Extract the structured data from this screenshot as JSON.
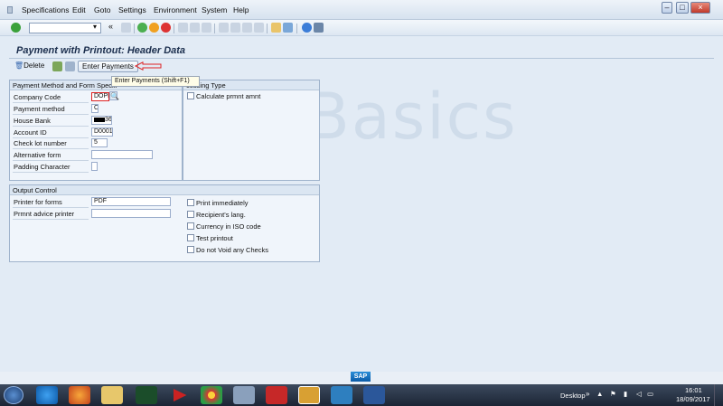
{
  "menu": [
    "Specifications",
    "Edit",
    "Goto",
    "Settings",
    "Environment",
    "System",
    "Help"
  ],
  "title": "Payment with Printout: Header Data",
  "app_toolbar": {
    "delete_label": "Delete",
    "enter_payments_label": "Enter Payments",
    "tooltip": "Enter Payments    (Shift+F1)"
  },
  "payment_group": {
    "title": "Payment Method and Form Specifi",
    "fields": [
      {
        "label": "Company Code",
        "value": "DOPD"
      },
      {
        "label": "Payment method",
        "value": "C"
      },
      {
        "label": "House Bank",
        "value": "36"
      },
      {
        "label": "Account ID",
        "value": "D0001"
      },
      {
        "label": "Check lot number",
        "value": "5"
      },
      {
        "label": "Alternative form",
        "value": ""
      },
      {
        "label": "Padding Character",
        "value": ""
      }
    ]
  },
  "processing_group": {
    "title": "cessing Type",
    "calc_label": "Calculate prmnt amnt"
  },
  "output_group": {
    "title": "Output Control",
    "printer_forms_label": "Printer for forms",
    "printer_forms_value": "PDF",
    "advice_printer_label": "Prmnt advice printer",
    "advice_printer_value": "",
    "checks": [
      "Print immediately",
      "Recipient's lang.",
      "Currency in ISO code",
      "Test printout",
      "Do not Void any Checks"
    ]
  },
  "watermark": "PostalBasics",
  "sap_logo": "SAP",
  "taskbar": {
    "desktop_label": "Desktop",
    "time": "16:01",
    "date": "18/09/2017"
  }
}
